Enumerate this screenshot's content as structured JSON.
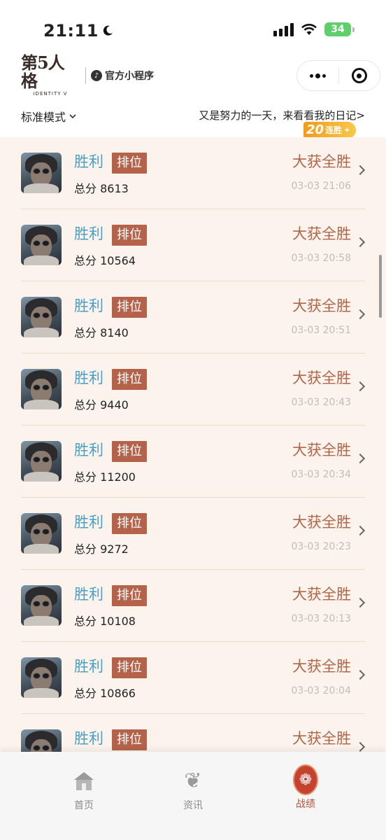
{
  "status_bar": {
    "time": "21:11",
    "battery": "34"
  },
  "header": {
    "logo_text": "第5人格",
    "logo_sub": "IDENTITY V",
    "mini_program_label": "官方小程序",
    "mini_program_icon": "tiktok-style-logo-icon"
  },
  "filter": {
    "mode": "标准模式",
    "diary_link": "又是努力的一天，来看看我的日记>",
    "streak_count": "20",
    "streak_label": "连胜"
  },
  "matches": [
    {
      "result": "胜利",
      "tag": "排位",
      "score": "总分 8613",
      "outcome": "大获全胜",
      "time": "03-03 21:06"
    },
    {
      "result": "胜利",
      "tag": "排位",
      "score": "总分 10564",
      "outcome": "大获全胜",
      "time": "03-03 20:58"
    },
    {
      "result": "胜利",
      "tag": "排位",
      "score": "总分 8140",
      "outcome": "大获全胜",
      "time": "03-03 20:51"
    },
    {
      "result": "胜利",
      "tag": "排位",
      "score": "总分 9440",
      "outcome": "大获全胜",
      "time": "03-03 20:43"
    },
    {
      "result": "胜利",
      "tag": "排位",
      "score": "总分 11200",
      "outcome": "大获全胜",
      "time": "03-03 20:34"
    },
    {
      "result": "胜利",
      "tag": "排位",
      "score": "总分 9272",
      "outcome": "大获全胜",
      "time": "03-03 20:23"
    },
    {
      "result": "胜利",
      "tag": "排位",
      "score": "总分 10108",
      "outcome": "大获全胜",
      "time": "03-03 20:13"
    },
    {
      "result": "胜利",
      "tag": "排位",
      "score": "总分 10866",
      "outcome": "大获全胜",
      "time": "03-03 20:04"
    },
    {
      "result": "胜利",
      "tag": "排位",
      "score": "",
      "outcome": "大获全胜",
      "time": ""
    }
  ],
  "tabs": [
    {
      "label": "首页",
      "icon": "home-icon",
      "active": false
    },
    {
      "label": "资讯",
      "icon": "news-icon",
      "active": false
    },
    {
      "label": "战绩",
      "icon": "record-emblem-icon",
      "active": true
    }
  ],
  "colors": {
    "list_background": "#fcf3ec",
    "win_text": "#4a9fc6",
    "tag_background": "#b4634a",
    "outcome_text": "#b16649",
    "active_tab": "#b5523a",
    "streak_gradient_start": "#f59a1b"
  }
}
